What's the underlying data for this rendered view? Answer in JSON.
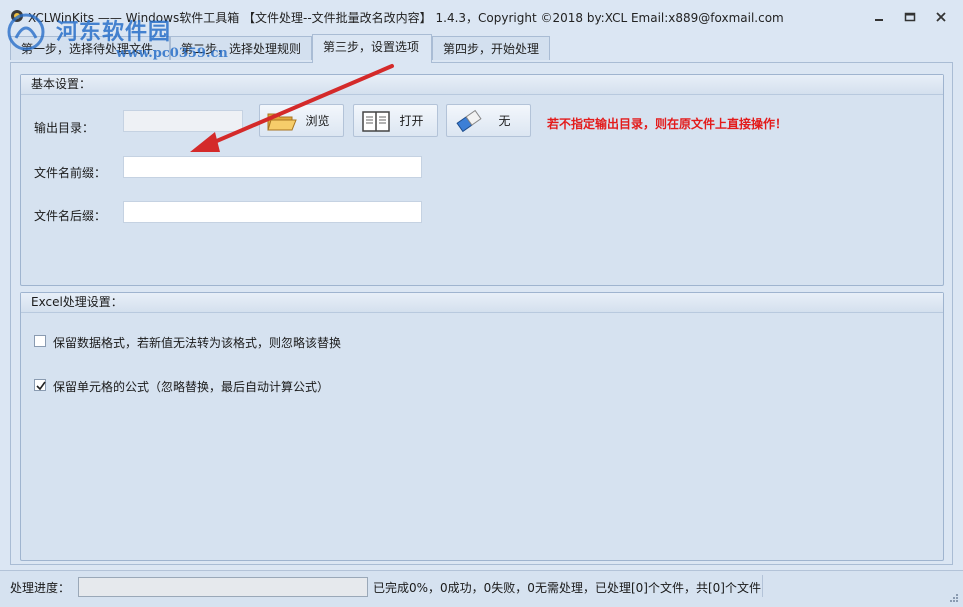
{
  "window": {
    "title": "XCLWinKits —— Windows软件工具箱 【文件处理--文件批量改名改内容】 1.4.3，Copyright ©2018 by:XCL Email:x889@foxmail.com",
    "controls": {
      "minimize_icon": "minimize-icon",
      "maximize_icon": "maximize-icon",
      "close_icon": "close-icon"
    }
  },
  "watermark": {
    "name": "河东软件园",
    "url": "www.pc0359.cn"
  },
  "tabs": [
    {
      "label": "第一步，选择待处理文件",
      "active": false
    },
    {
      "label": "第二步，选择处理规则",
      "active": false
    },
    {
      "label": "第三步，设置选项",
      "active": true
    },
    {
      "label": "第四步，开始处理",
      "active": false
    }
  ],
  "basic_settings": {
    "title": "基本设置：",
    "output_dir": {
      "label": "输出目录：",
      "value": ""
    },
    "buttons": [
      {
        "label": "浏览",
        "icon": "folder-icon"
      },
      {
        "label": "打开",
        "icon": "book-icon"
      },
      {
        "label": "无",
        "icon": "eraser-icon"
      }
    ],
    "hint": "若不指定输出目录，则在原文件上直接操作！",
    "prefix": {
      "label": "文件名前缀：",
      "value": ""
    },
    "suffix": {
      "label": "文件名后缀：",
      "value": ""
    }
  },
  "excel_settings": {
    "title": "Excel处理设置：",
    "options": [
      {
        "label": "保留数据格式，若新值无法转为该格式，则忽略该替换",
        "checked": false
      },
      {
        "label": "保留单元格的公式（忽略替换，最后自动计算公式）",
        "checked": true
      }
    ]
  },
  "status": {
    "progress_label": "处理进度：",
    "progress_percent": 0,
    "summary": "已完成0%，0成功，0失败，0无需处理，已处理[0]个文件，共[0]个文件"
  },
  "colors": {
    "accent": "#2c6fc6",
    "hint": "#e31b1b",
    "annotation_arrow": "#d42a2a"
  }
}
